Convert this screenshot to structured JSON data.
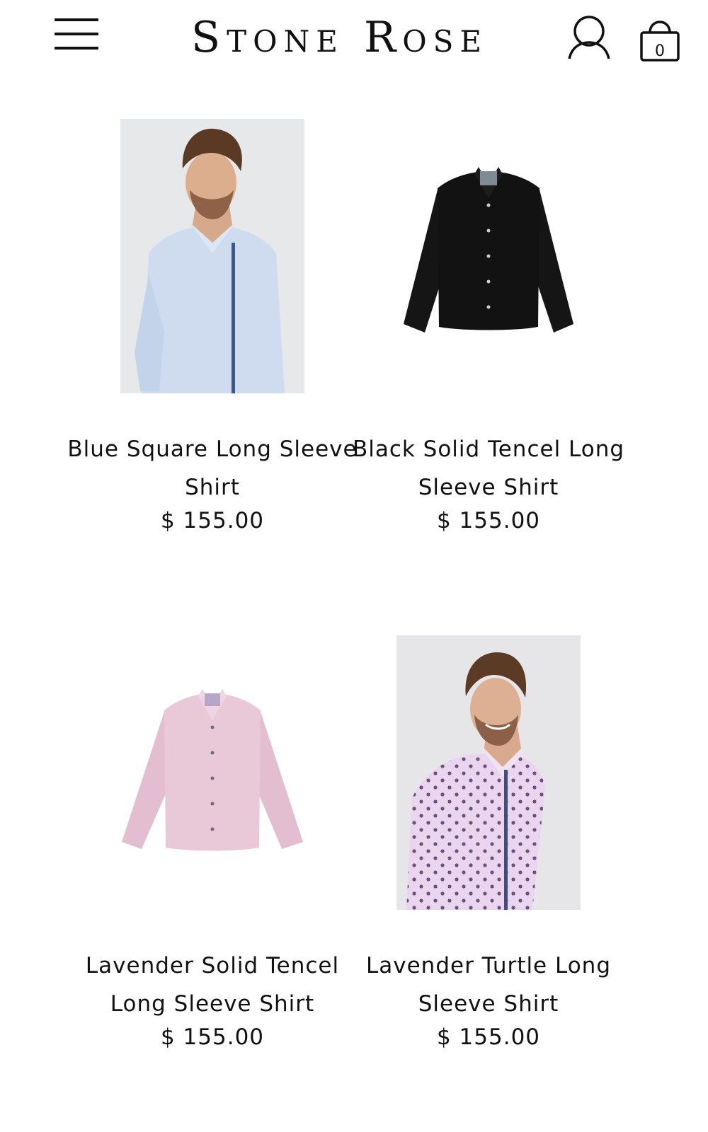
{
  "header": {
    "logo": "Stone Rose",
    "cart_count": "0"
  },
  "products": [
    {
      "name": "Blue Square Long Sleeve Shirt",
      "price": "$ 155.00",
      "shirt_color": "#cfdcef"
    },
    {
      "name": "Black Solid Tencel Long Sleeve Shirt",
      "price": "$ 155.00",
      "shirt_color": "#121212"
    },
    {
      "name": "Lavender Solid Tencel Long Sleeve Shirt",
      "price": "$ 155.00",
      "shirt_color": "#e9c9d8"
    },
    {
      "name": "Lavender Turtle Long Sleeve Shirt",
      "price": "$ 155.00",
      "shirt_color": "#ead5ee"
    }
  ],
  "icons": [
    "menu-icon",
    "account-icon",
    "cart-icon"
  ]
}
